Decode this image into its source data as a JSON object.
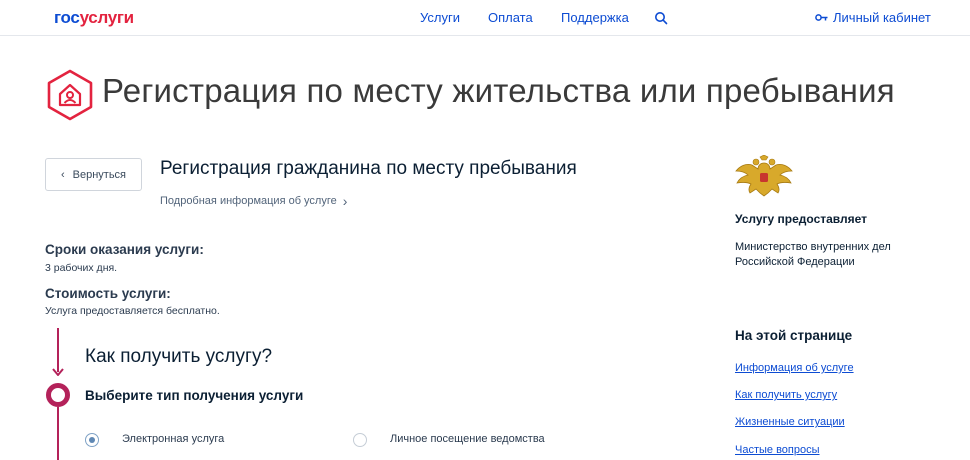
{
  "header": {
    "logo_part1": "гос",
    "logo_part2": "услуги",
    "nav": [
      "Услуги",
      "Оплата",
      "Поддержка"
    ],
    "search_icon": "search-icon",
    "cabinet_label": "Личный кабинет",
    "cabinet_icon": "key-icon"
  },
  "page": {
    "title": "Регистрация по месту жительства или пребывания",
    "title_icon": "house-in-hexagon-icon"
  },
  "service": {
    "back_label": "Вернуться",
    "title": "Регистрация гражданина по месту пребывания",
    "more_info": "Подробная информация об услуге"
  },
  "terms": {
    "label": "Сроки оказания услуги:",
    "value": "3 рабочих дня."
  },
  "cost": {
    "label": "Стоимость услуги:",
    "value": "Услуга предоставляется бесплатно."
  },
  "steps": {
    "how_title": "Как получить услугу?",
    "choose_title": "Выберите тип получения услуги",
    "options": [
      {
        "label": "Электронная услуга",
        "selected": true
      },
      {
        "label": "Личное посещение ведомства",
        "selected": false
      }
    ]
  },
  "provider": {
    "emblem": "double-headed-eagle-emblem",
    "title": "Услугу предоставляет",
    "name": "Министерство внутренних дел Российской Федерации"
  },
  "on_page": {
    "title": "На этой странице",
    "links": [
      "Информация об услуге",
      "Как получить услугу",
      "Жизненные ситуации",
      "Частые вопросы"
    ]
  },
  "colors": {
    "brand_blue": "#0d4cd3",
    "brand_red": "#e3233f",
    "accent_magenta": "#b4225a"
  }
}
